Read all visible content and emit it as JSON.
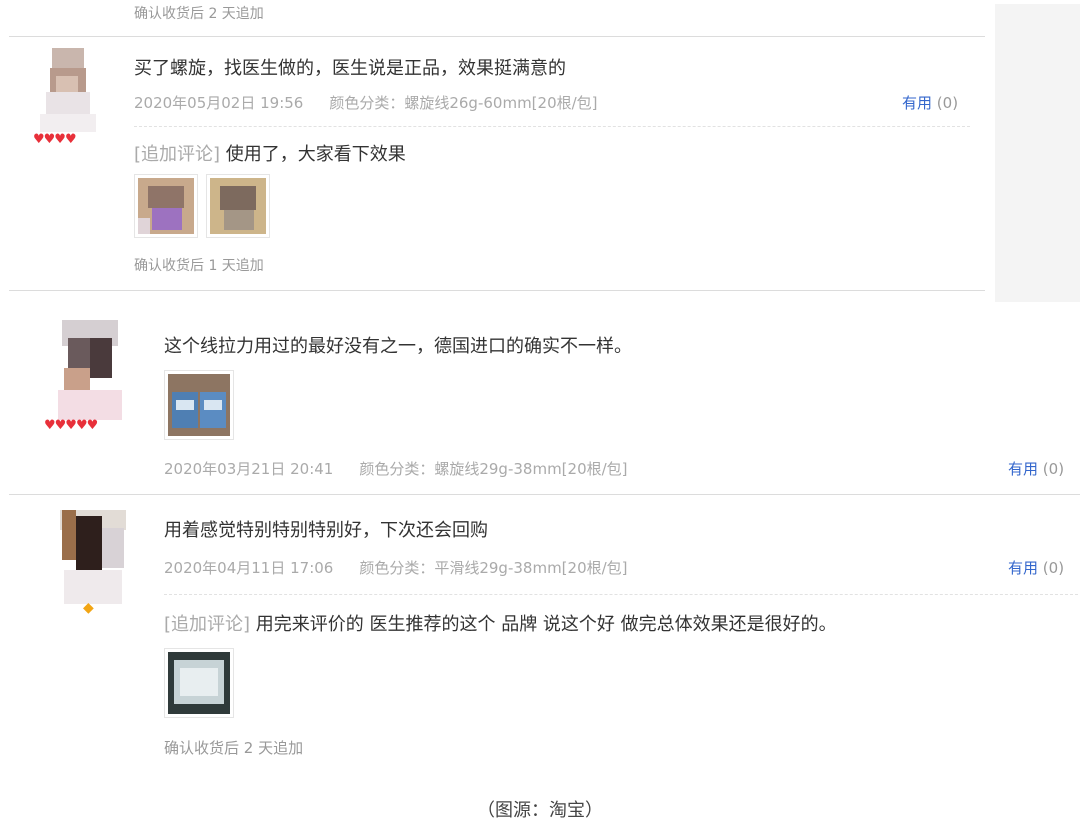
{
  "reviews": [
    {
      "append_note": "确认收货后 2 天追加"
    },
    {
      "text": "买了螺旋，找医生做的，医生说是正品，效果挺满意的",
      "date": "2020年05月02日 19:56",
      "spec": "颜色分类：螺旋线26g-60mm[20根/包]",
      "useful_label": "有用",
      "useful_count": "(0)",
      "append_tag": "[追加评论]",
      "append_text": " 使用了，大家看下效果",
      "append_note": "确认收货后 1 天追加",
      "level_icon": "heart-badges"
    },
    {
      "text": "这个线拉力用过的最好没有之一，德国进口的确实不一样。",
      "date": "2020年03月21日 20:41",
      "spec": "颜色分类：螺旋线29g-38mm[20根/包]",
      "useful_label": "有用",
      "useful_count": "(0)",
      "level_icon": "heart-badges"
    },
    {
      "text": "用着感觉特别特别特别好，下次还会回购",
      "date": "2020年04月11日 17:06",
      "spec": "颜色分类：平滑线29g-38mm[20根/包]",
      "useful_label": "有用",
      "useful_count": "(0)",
      "append_tag": "[追加评论]",
      "append_text": " 用完来评价的 医生推荐的这个 品牌 说这个好 做完总体效果还是很好的。",
      "append_note": "确认收货后 2 天追加",
      "level_icon": "diamond-badge"
    }
  ],
  "caption": "（图源：淘宝）",
  "colors": {
    "link_blue": "#3366cc",
    "meta_gray": "#aaaaaa",
    "heart_red": "#e8303a",
    "diamond_gold": "#f2a514"
  }
}
